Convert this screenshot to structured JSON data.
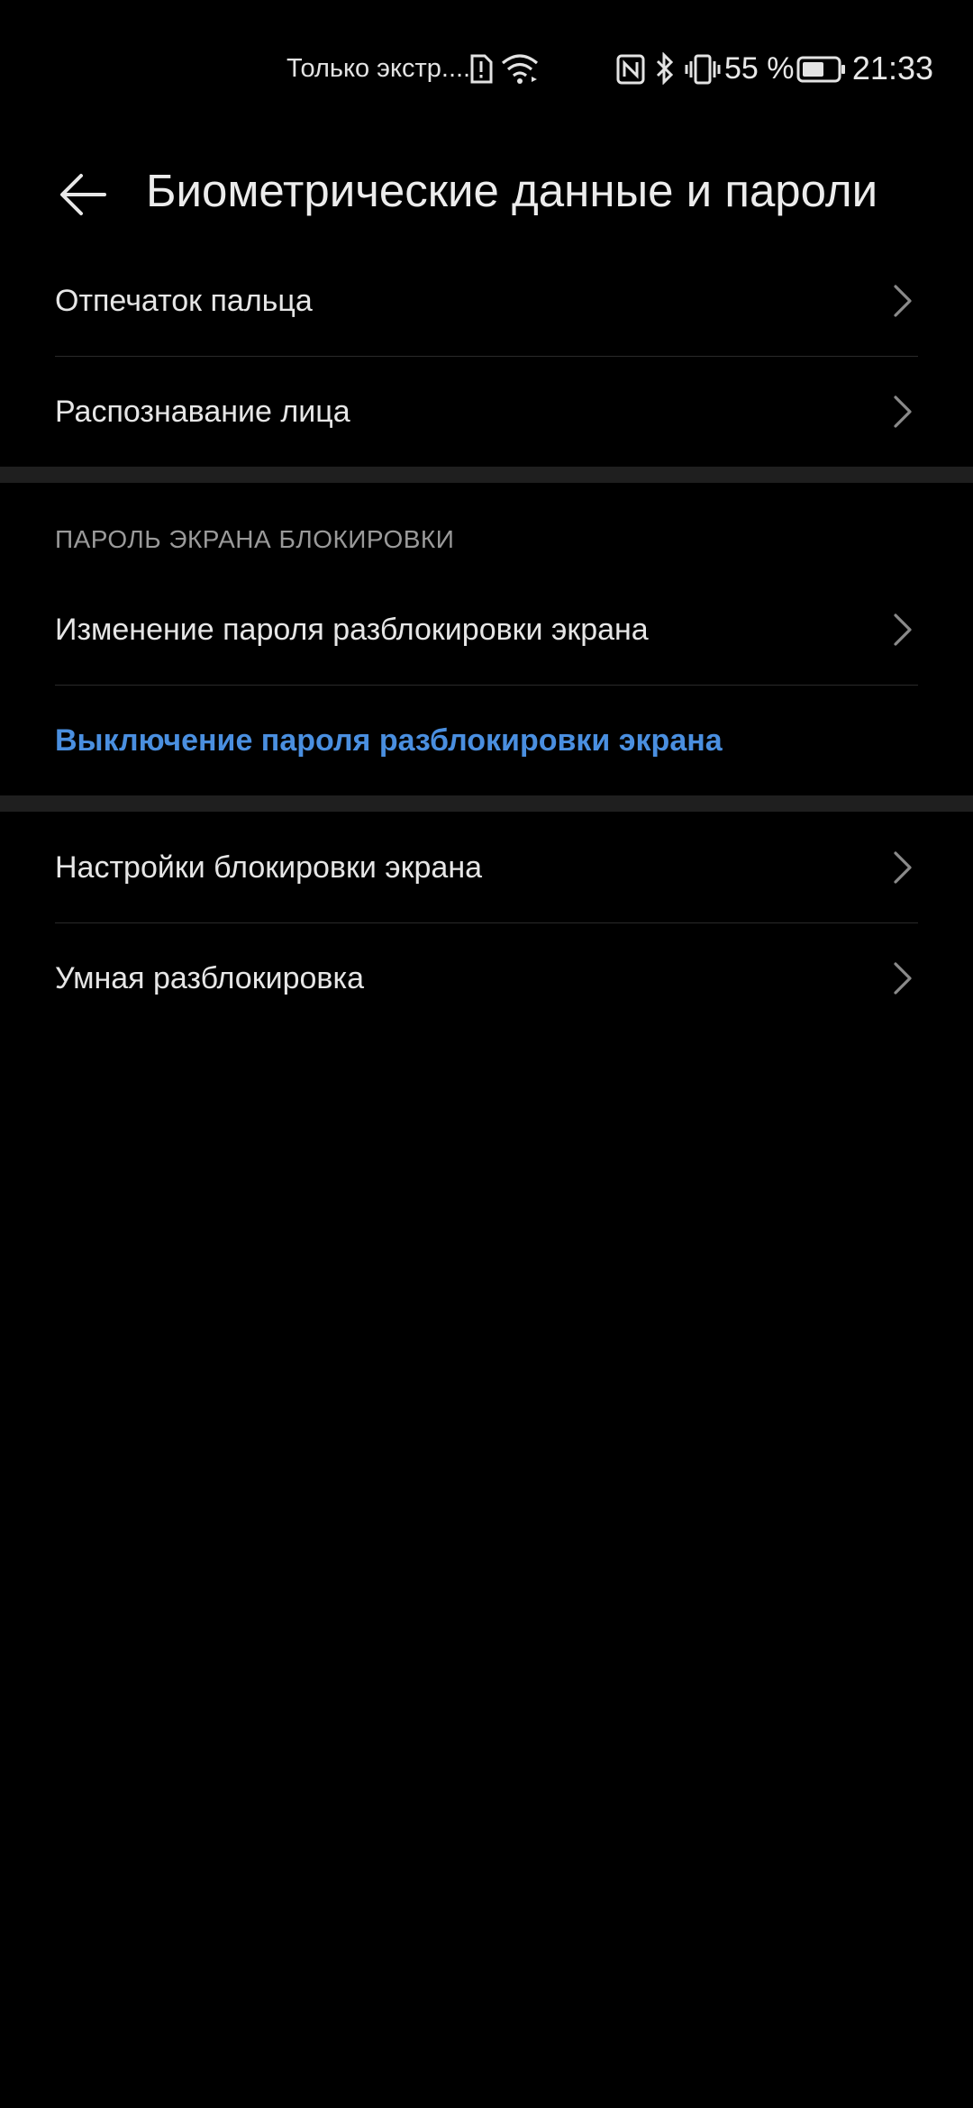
{
  "status_bar": {
    "carrier": "Только экстр....",
    "battery_percent": "55 %",
    "time": "21:33",
    "icons": [
      "sim-alert-icon",
      "wifi-icon",
      "nfc-icon",
      "bluetooth-icon",
      "vibrate-icon",
      "battery-icon"
    ]
  },
  "header": {
    "back_icon": "arrow-left-icon",
    "title": "Биометрические данные и пароли"
  },
  "biometrics": {
    "items": [
      {
        "label": "Отпечаток пальца"
      },
      {
        "label": "Распознавание лица"
      }
    ]
  },
  "lock_password": {
    "section_title": "ПАРОЛЬ ЭКРАНА БЛОКИРОВКИ",
    "items": [
      {
        "label": "Изменение пароля разблокировки экрана"
      },
      {
        "label": "Выключение пароля разблокировки экрана"
      }
    ]
  },
  "lock_settings": {
    "items": [
      {
        "label": "Настройки блокировки экрана"
      },
      {
        "label": "Умная разблокировка"
      }
    ]
  },
  "colors": {
    "background": "#000000",
    "accent": "#4a8fe0",
    "section_band": "#1f1f1f",
    "text": "#e6e6e6"
  }
}
